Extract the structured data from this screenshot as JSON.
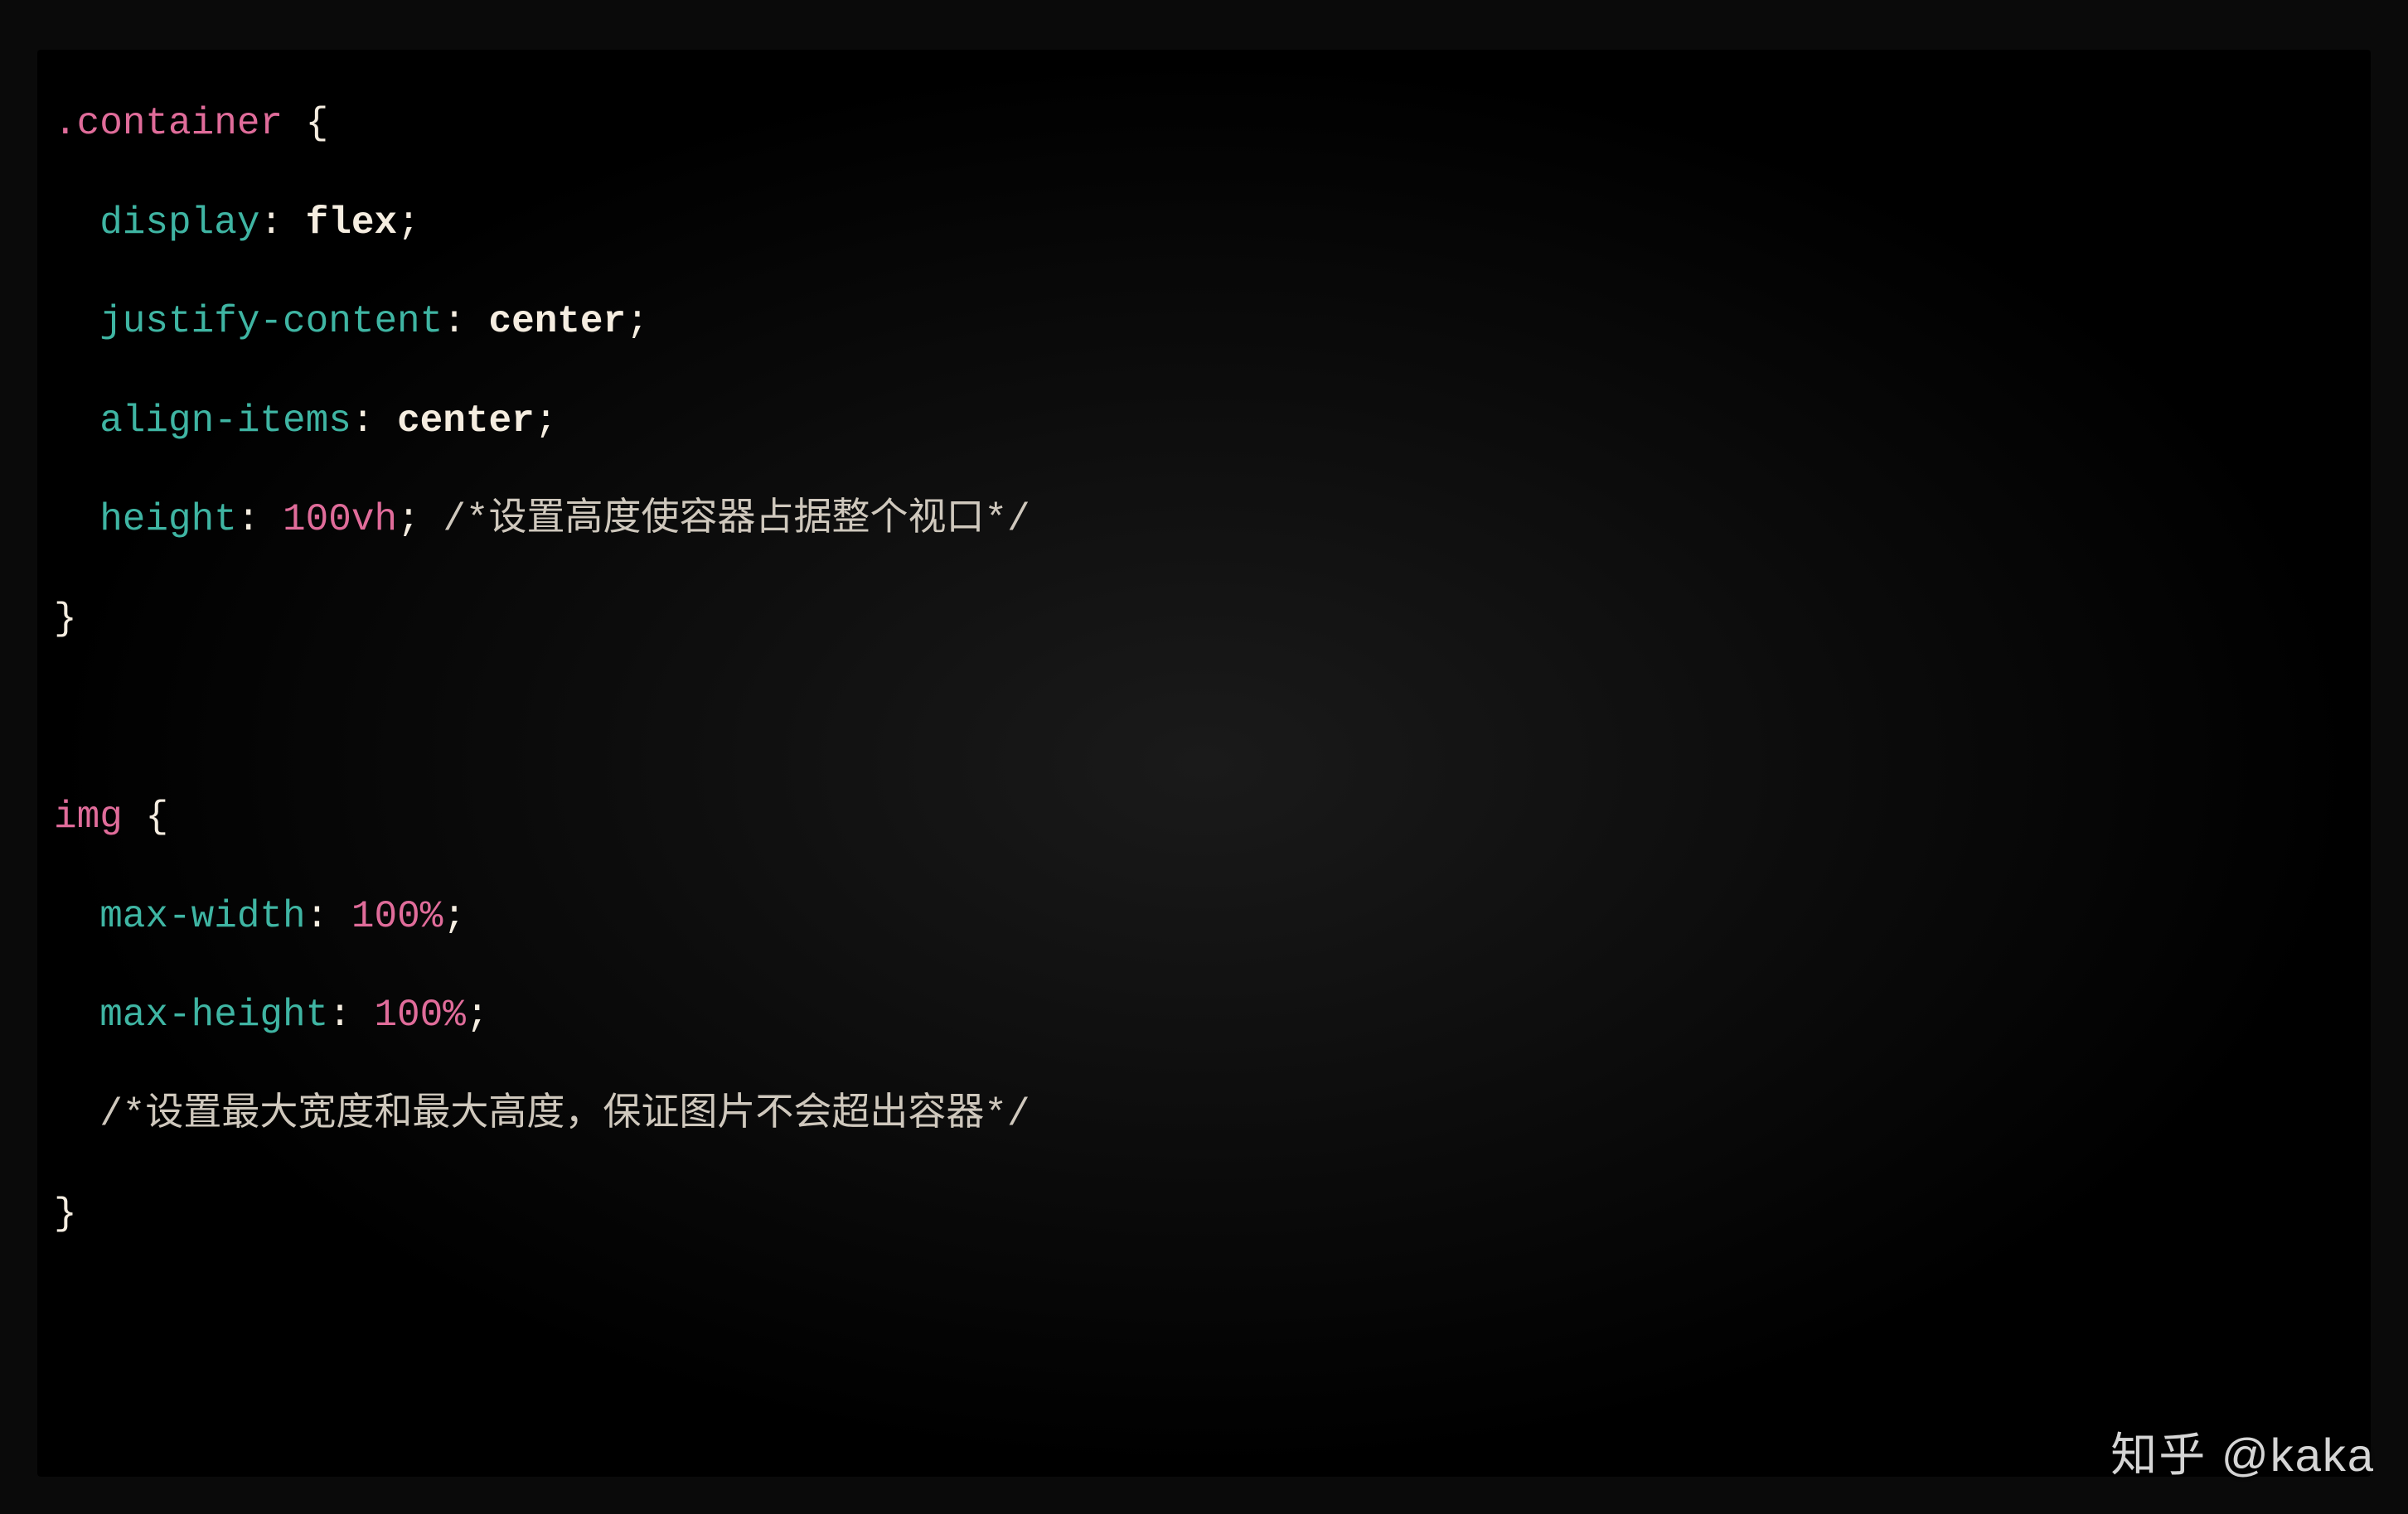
{
  "watermark": "知乎 @kaka",
  "code": {
    "rule1": {
      "selector": ".container",
      "decls": [
        {
          "prop": "display",
          "val": "flex",
          "type": "kw"
        },
        {
          "prop": "justify-content",
          "val": "center",
          "type": "kw"
        },
        {
          "prop": "align-items",
          "val": "center",
          "type": "kw"
        },
        {
          "prop": "height",
          "val": "100",
          "unit": "vh",
          "type": "num",
          "comment": "/*设置高度使容器占据整个视口*/"
        }
      ]
    },
    "rule2": {
      "selector": "img",
      "decls": [
        {
          "prop": "max-width",
          "val": "100",
          "unit": "%",
          "type": "num"
        },
        {
          "prop": "max-height",
          "val": "100",
          "unit": "%",
          "type": "num"
        }
      ],
      "trailing_comment": "/*设置最大宽度和最大高度，保证图片不会超出容器*/"
    }
  }
}
